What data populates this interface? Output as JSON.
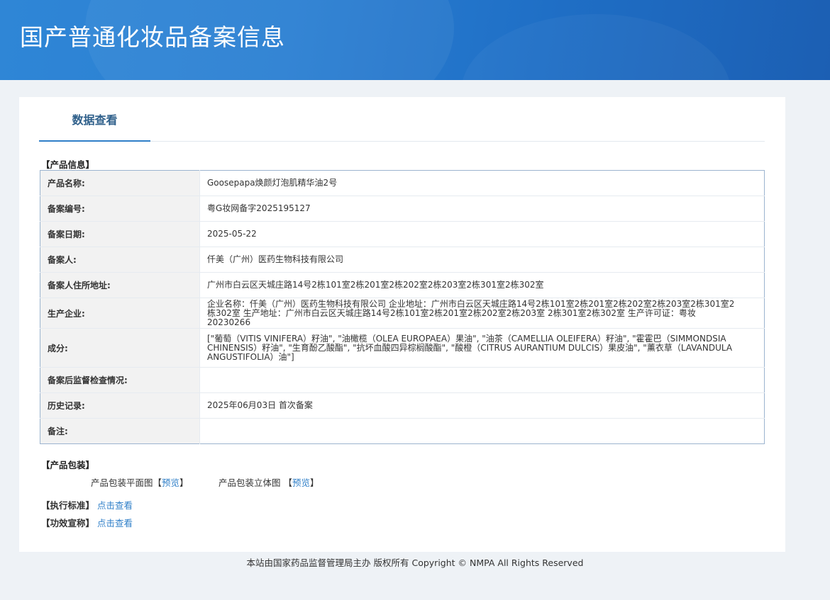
{
  "header": {
    "title": "国产普通化妆品备案信息"
  },
  "tabs": [
    {
      "label": "数据查看"
    }
  ],
  "product_info": {
    "section_title": "【产品信息】",
    "rows": [
      {
        "key": "产品名称:",
        "value": "Goosepapa焕颜灯泡肌精华油2号"
      },
      {
        "key": "备案编号:",
        "value": "粤G妆网备字2025195127"
      },
      {
        "key": "备案日期:",
        "value": "2025-05-22"
      },
      {
        "key": "备案人:",
        "value": "仟美（广州）医药生物科技有限公司"
      },
      {
        "key": "备案人住所地址:",
        "value": "广州市白云区天城庄路14号2栋101室2栋201室2栋202室2栋203室2栋301室2栋302室"
      },
      {
        "key": "生产企业:",
        "value": "企业名称：仟美（广州）医药生物科技有限公司 企业地址：广州市白云区天城庄路14号2栋101室2栋201室2栋202室2栋203室2栋301室2栋302室 生产地址：广州市白云区天城庄路14号2栋101室2栋201室2栋202室2栋203室 2栋301室2栋302室 生产许可证：粤妆20230266"
      },
      {
        "key": "成分:",
        "value": "[\"葡萄（VITIS VINIFERA）籽油\", \"油橄榄（OLEA EUROPAEA）果油\", \"油茶（CAMELLIA OLEIFERA）籽油\", \"霍霍巴（SIMMONDSIA CHINENSIS）籽油\", \"生育酚乙酸酯\", \"抗坏血酸四异棕榈酸酯\", \"酸橙（CITRUS AURANTIUM DULCIS）果皮油\", \"薰衣草（LAVANDULA ANGUSTIFOLIA）油\"]"
      },
      {
        "key": "备案后监督检查情况:",
        "value": ""
      },
      {
        "key": "历史记录:",
        "value": "2025年06月03日 首次备案"
      },
      {
        "key": "备注:",
        "value": ""
      }
    ]
  },
  "packaging": {
    "section_title": "【产品包装】",
    "flat_label": "产品包装平面图",
    "stereo_label": "产品包装立体图",
    "preview_link": "预览",
    "bracket_open": "【",
    "bracket_close": "】"
  },
  "standard": {
    "label": "【执行标准】",
    "link": "点击查看"
  },
  "efficacy": {
    "label": "【功效宣称】",
    "link": "点击查看"
  },
  "footer": {
    "text": "本站由国家药品监督管理局主办 版权所有 Copyright © NMPA All Rights Reserved"
  },
  "colors": {
    "banner": "#2a7fd2",
    "accent": "#2f7fc8",
    "table_border": "#9cb4cf"
  }
}
